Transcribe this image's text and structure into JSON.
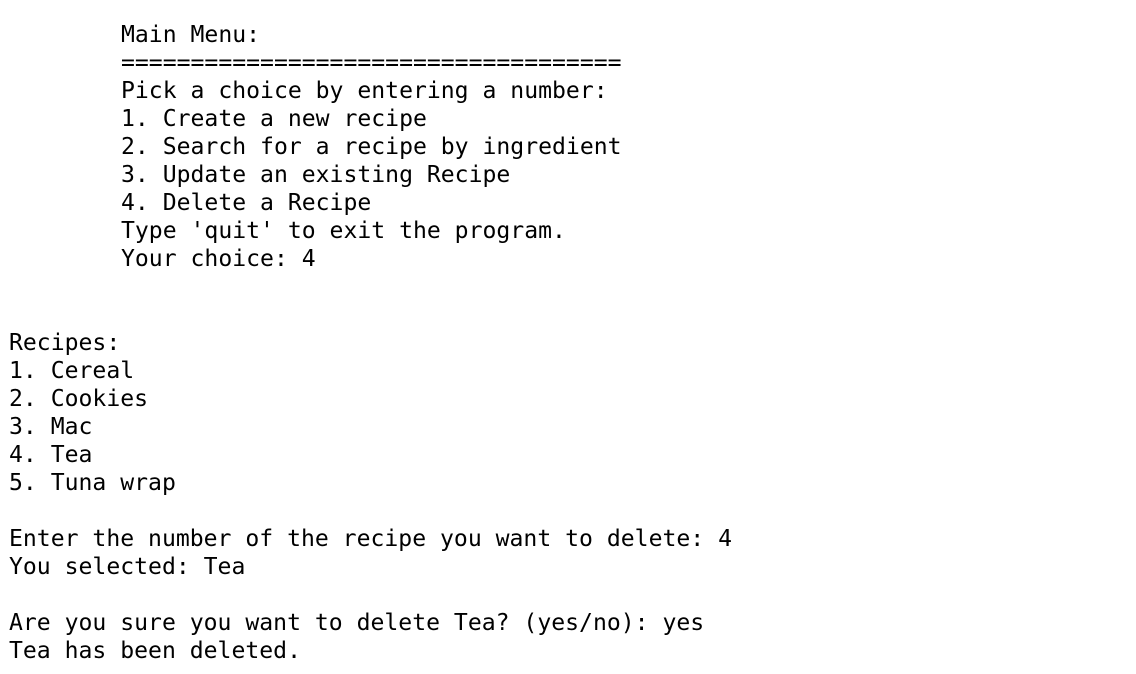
{
  "main_menu": {
    "title": "Main Menu:",
    "divider": "====================================",
    "prompt": "Pick a choice by entering a number:",
    "options": [
      "1. Create a new recipe",
      "2. Search for a recipe by ingredient",
      "3. Update an existing Recipe",
      "4. Delete a Recipe"
    ],
    "quit_hint": "Type 'quit' to exit the program.",
    "choice_prompt": "Your choice: 4"
  },
  "recipes": {
    "heading": "Recipes:",
    "items": [
      "1. Cereal",
      "2. Cookies",
      "3. Mac",
      "4. Tea",
      "5. Tuna wrap"
    ]
  },
  "delete_flow": {
    "number_prompt": "Enter the number of the recipe you want to delete: 4",
    "selection": "You selected: Tea",
    "confirm_prompt": "Are you sure you want to delete Tea? (yes/no): yes",
    "result": "Tea has been deleted."
  }
}
